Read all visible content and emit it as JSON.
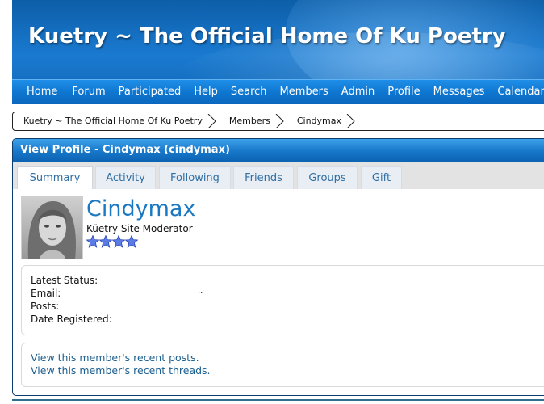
{
  "site": {
    "title": "Kuetry ~ The Official Home Of Ku Poetry"
  },
  "nav": {
    "items": [
      "Home",
      "Forum",
      "Participated",
      "Help",
      "Search",
      "Members",
      "Admin",
      "Profile",
      "Messages",
      "Calendar"
    ]
  },
  "breadcrumb": [
    "Kuetry ~ The Official Home Of Ku Poetry",
    "Members",
    "Cindymax"
  ],
  "profile": {
    "heading": "View Profile - Cindymax (cindymax)",
    "tabs": [
      "Summary",
      "Activity",
      "Following",
      "Friends",
      "Groups",
      "Gift"
    ],
    "active_tab": "Summary",
    "name": "Cindymax",
    "member_title": "Küetry Site Moderator",
    "rating_stars": 4,
    "fields": {
      "latest_status": "Latest Status:",
      "email": "Email:",
      "email_value": "..",
      "posts": "Posts:",
      "date_registered": "Date Registered:"
    },
    "links": {
      "recent_posts": "View this member's recent posts.",
      "recent_threads": "View this member's recent threads."
    }
  },
  "colors": {
    "header_blue": "#1570c2",
    "nav_blue": "#0f77d1",
    "name_blue": "#1a78c2",
    "link_blue": "#1c5f8f",
    "star_blue": "#4f6fe0"
  },
  "icons": {
    "star": "star-icon",
    "breadcrumb_separator": "chevron-right-icon",
    "avatar": "member-avatar"
  }
}
